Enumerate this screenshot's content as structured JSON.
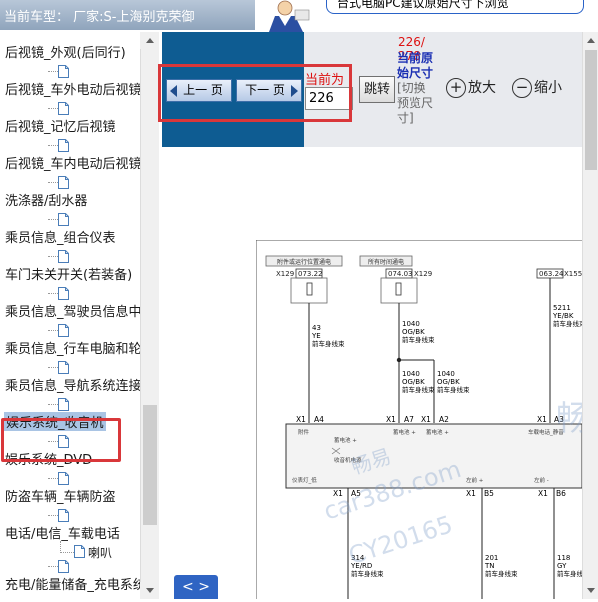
{
  "header": {
    "car_model": "当前车型：  厂家:S-上海别克荣御",
    "notice": "台式电脑PC建议原始尺寸下浏览"
  },
  "sidebar": {
    "items": [
      {
        "label": "后视镜_外观(后同行)"
      },
      {
        "label": "后视镜_车外电动后视镜"
      },
      {
        "label": "后视镜_记忆后视镜"
      },
      {
        "label": "后视镜_车内电动后视镜"
      },
      {
        "label": "洗涤器/刮水器"
      },
      {
        "label": "乘员信息_组合仪表"
      },
      {
        "label": "车门未关开关(若装备)"
      },
      {
        "label": "乘员信息_驾驶员信息中"
      },
      {
        "label": "乘员信息_行车电脑和轮"
      },
      {
        "label": "乘员信息_导航系统连接"
      },
      {
        "label": "娱乐系统_收音机",
        "selected": true
      },
      {
        "label": "娱乐系统_DVD"
      },
      {
        "label": "防盗车辆_车辆防盗"
      },
      {
        "label": "电话/电信_车载电话"
      },
      {
        "label": "充电/能量储备_充电系统"
      }
    ],
    "sub_item": "喇叭"
  },
  "toolbar": {
    "prev_label": "上一 页",
    "next_label": "下一 页",
    "current_label": "当前为",
    "current_page": "226",
    "jump_label": "跳转",
    "page_count": "226/\n278",
    "orig_size_label": "当前原始尺寸",
    "switch_label": "[切换预览尺寸]",
    "zoom_in_label": "放大",
    "zoom_out_label": "缩小",
    "pager_label": "< >"
  },
  "diagram": {
    "box_left": "附件或运行位置通电",
    "box_right": "所有时间通电",
    "conn_left": "073.22",
    "conn_left_x": "X129",
    "conn_mid": "074.03",
    "conn_mid_x": "X129",
    "conn_right": "063.24",
    "conn_right_x": "X155",
    "wire_43": "43",
    "wire_43_color": "YE",
    "wire_1040": "1040",
    "wire_1040_color": "OG/BK",
    "wire_5211": "5211",
    "wire_5211_color": "YE/BK",
    "harness": "前车身线束",
    "pins_top": [
      "X1",
      "A4",
      "X1",
      "A7",
      "X1",
      "A2",
      "X1",
      "A3"
    ],
    "pin_label_left": "附件",
    "pin_label_b1": "蓄电池 +",
    "pin_label_b2": "蓄电池 +",
    "pin_label_r": "车载电话_静音",
    "inner_1": "蓄电池 +",
    "inner_2": "收音机电源",
    "inner_3": "仪表灯_低",
    "inner_4": "左前 +",
    "inner_5": "左前 -",
    "pins_bottom": [
      "X1",
      "A5",
      "X1",
      "B5",
      "X1",
      "B6"
    ],
    "wire_314": "314",
    "wire_314_color": "YE/RD",
    "wire_201": "201",
    "wire_201_color": "TN",
    "wire_118": "118",
    "wire_118_color": "GY",
    "watermark_1": "畅易",
    "watermark_2": "car388.com",
    "watermark_3": "CY20165"
  }
}
